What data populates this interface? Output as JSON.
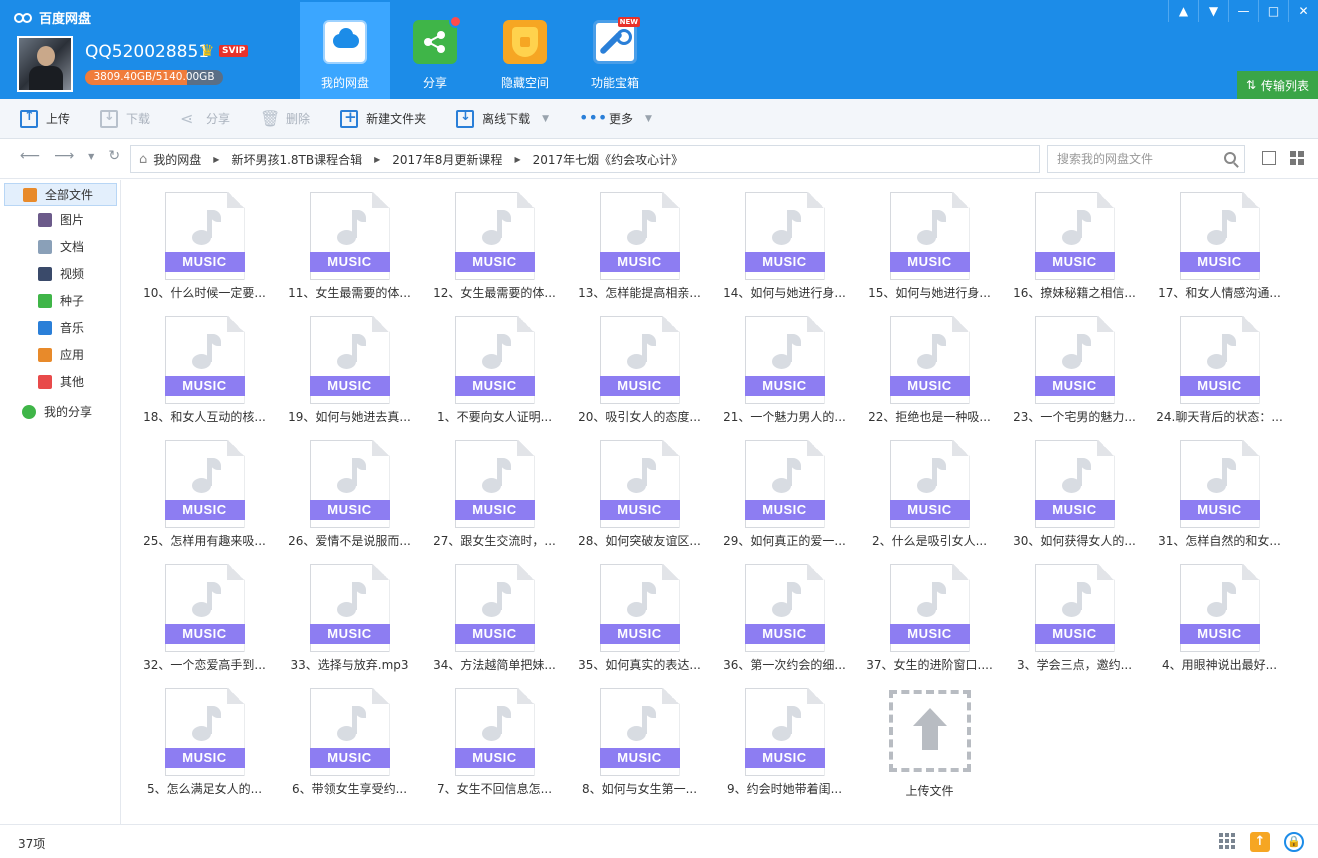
{
  "app": {
    "title": "百度网盘"
  },
  "user": {
    "name": "QQ520028851",
    "vip": "SVIP",
    "quota_text": "3809.40GB/5140.00GB",
    "quota_used_fraction": 0.741
  },
  "nav": [
    {
      "label": "我的网盘",
      "icon": "cloud-drive-icon",
      "active": true
    },
    {
      "label": "分享",
      "icon": "share-icon"
    },
    {
      "label": "隐藏空间",
      "icon": "lock-shield-icon"
    },
    {
      "label": "功能宝箱",
      "icon": "toolbox-icon",
      "badge": "NEW"
    }
  ],
  "window_controls": [
    "▲",
    "▼",
    "—",
    "□",
    "✕"
  ],
  "transfer_list": {
    "label": "传输列表"
  },
  "toolbar": {
    "upload": "上传",
    "download": "下载",
    "share": "分享",
    "delete": "删除",
    "new_folder": "新建文件夹",
    "offline_download": "离线下载",
    "more": "更多"
  },
  "breadcrumb": [
    "我的网盘",
    "新坏男孩1.8TB课程合辑",
    "2017年8月更新课程",
    "2017年七烟《约会攻心计》"
  ],
  "search": {
    "placeholder": "搜索我的网盘文件"
  },
  "sidebar": {
    "all_files": "全部文件",
    "items": [
      {
        "label": "图片",
        "icon": "image-icon",
        "color": "#6b5a8a"
      },
      {
        "label": "文档",
        "icon": "document-icon",
        "color": "#8aa0b8"
      },
      {
        "label": "视频",
        "icon": "video-icon",
        "color": "#3a4a6a"
      },
      {
        "label": "种子",
        "icon": "bt-icon",
        "color": "#3fb548"
      },
      {
        "label": "音乐",
        "icon": "music-icon",
        "color": "#2a7fd8"
      },
      {
        "label": "应用",
        "icon": "app-icon",
        "color": "#e88a2a"
      },
      {
        "label": "其他",
        "icon": "other-icon",
        "color": "#e84a4a"
      }
    ],
    "my_share": "我的分享"
  },
  "file_type_label": "MUSIC",
  "files": [
    "10、什么时候一定要...",
    "11、女生最需要的体...",
    "12、女生最需要的体...",
    "13、怎样能提高相亲...",
    "14、如何与她进行身...",
    "15、如何与她进行身...",
    "16、撩妹秘籍之相信...",
    "17、和女人情感沟通...",
    "18、和女人互动的核...",
    "19、如何与她进去真...",
    "1、不要向女人证明...",
    "20、吸引女人的态度...",
    "21、一个魅力男人的...",
    "22、拒绝也是一种吸...",
    "23、一个宅男的魅力...",
    "24.聊天背后的状态：...",
    "25、怎样用有趣来吸...",
    "26、爱情不是说服而...",
    "27、跟女生交流时，...",
    "28、如何突破友谊区...",
    "29、如何真正的爱一...",
    "2、什么是吸引女人...",
    "30、如何获得女人的...",
    "31、怎样自然的和女...",
    "32、一个恋爱高手到...",
    "33、选择与放弃.mp3",
    "34、方法越简单把妹...",
    "35、如何真实的表达...",
    "36、第一次约会的细...",
    "37、女生的进阶窗口....",
    "3、学会三点，邀约...",
    "4、用眼神说出最好...",
    "5、怎么满足女人的...",
    "6、带领女生享受约...",
    "7、女生不回信息怎...",
    "8、如何与女生第一...",
    "9、约会时她带着闺..."
  ],
  "upload_tile": {
    "label": "上传文件"
  },
  "status": {
    "count": "37项"
  }
}
